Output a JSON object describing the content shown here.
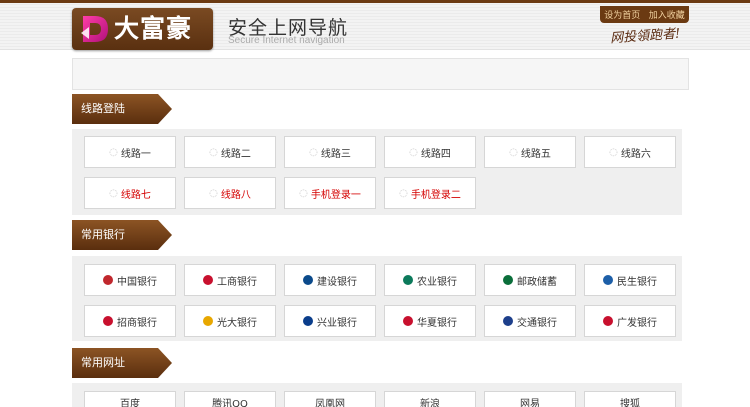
{
  "header": {
    "logo_text": "大富豪",
    "title": "安全上网导航",
    "subtitle": "Secure Internet navigation",
    "links": [
      "设为首页",
      "加入收藏"
    ],
    "slogan": "网投領跑者!"
  },
  "sections": [
    {
      "title": "线路登陆",
      "items": [
        {
          "label": "线路一",
          "red": false
        },
        {
          "label": "线路二",
          "red": false
        },
        {
          "label": "线路三",
          "red": false
        },
        {
          "label": "线路四",
          "red": false
        },
        {
          "label": "线路五",
          "red": false
        },
        {
          "label": "线路六",
          "red": false
        },
        {
          "label": "线路七",
          "red": true
        },
        {
          "label": "线路八",
          "red": true
        },
        {
          "label": "手机登录一",
          "red": true
        },
        {
          "label": "手机登录二",
          "red": true
        }
      ]
    },
    {
      "title": "常用银行",
      "items": [
        {
          "label": "中国银行",
          "icon_color": "#c0272d",
          "icon": "bank-of-china-icon"
        },
        {
          "label": "工商银行",
          "icon_color": "#c8102e",
          "icon": "icbc-icon"
        },
        {
          "label": "建设银行",
          "icon_color": "#0b4a8b",
          "icon": "ccb-icon"
        },
        {
          "label": "农业银行",
          "icon_color": "#0c7a5b",
          "icon": "abc-icon"
        },
        {
          "label": "邮政储蓄",
          "icon_color": "#0a6e3a",
          "icon": "postal-savings-icon"
        },
        {
          "label": "民生银行",
          "icon_color": "#1d5fa8",
          "icon": "cmbc-icon"
        },
        {
          "label": "招商银行",
          "icon_color": "#c8102e",
          "icon": "cmb-icon"
        },
        {
          "label": "光大银行",
          "icon_color": "#e8a700",
          "icon": "ceb-icon"
        },
        {
          "label": "兴业银行",
          "icon_color": "#0a3d8b",
          "icon": "cib-icon"
        },
        {
          "label": "华夏银行",
          "icon_color": "#c8102e",
          "icon": "hxb-icon"
        },
        {
          "label": "交通银行",
          "icon_color": "#1d3f8b",
          "icon": "bocom-icon"
        },
        {
          "label": "广发银行",
          "icon_color": "#c8102e",
          "icon": "cgb-icon"
        }
      ]
    },
    {
      "title": "常用网址",
      "items": [
        {
          "label": "百度"
        },
        {
          "label": "腾讯QQ"
        },
        {
          "label": "凤凰网"
        },
        {
          "label": "新浪"
        },
        {
          "label": "网易"
        },
        {
          "label": "搜狐"
        }
      ]
    }
  ]
}
